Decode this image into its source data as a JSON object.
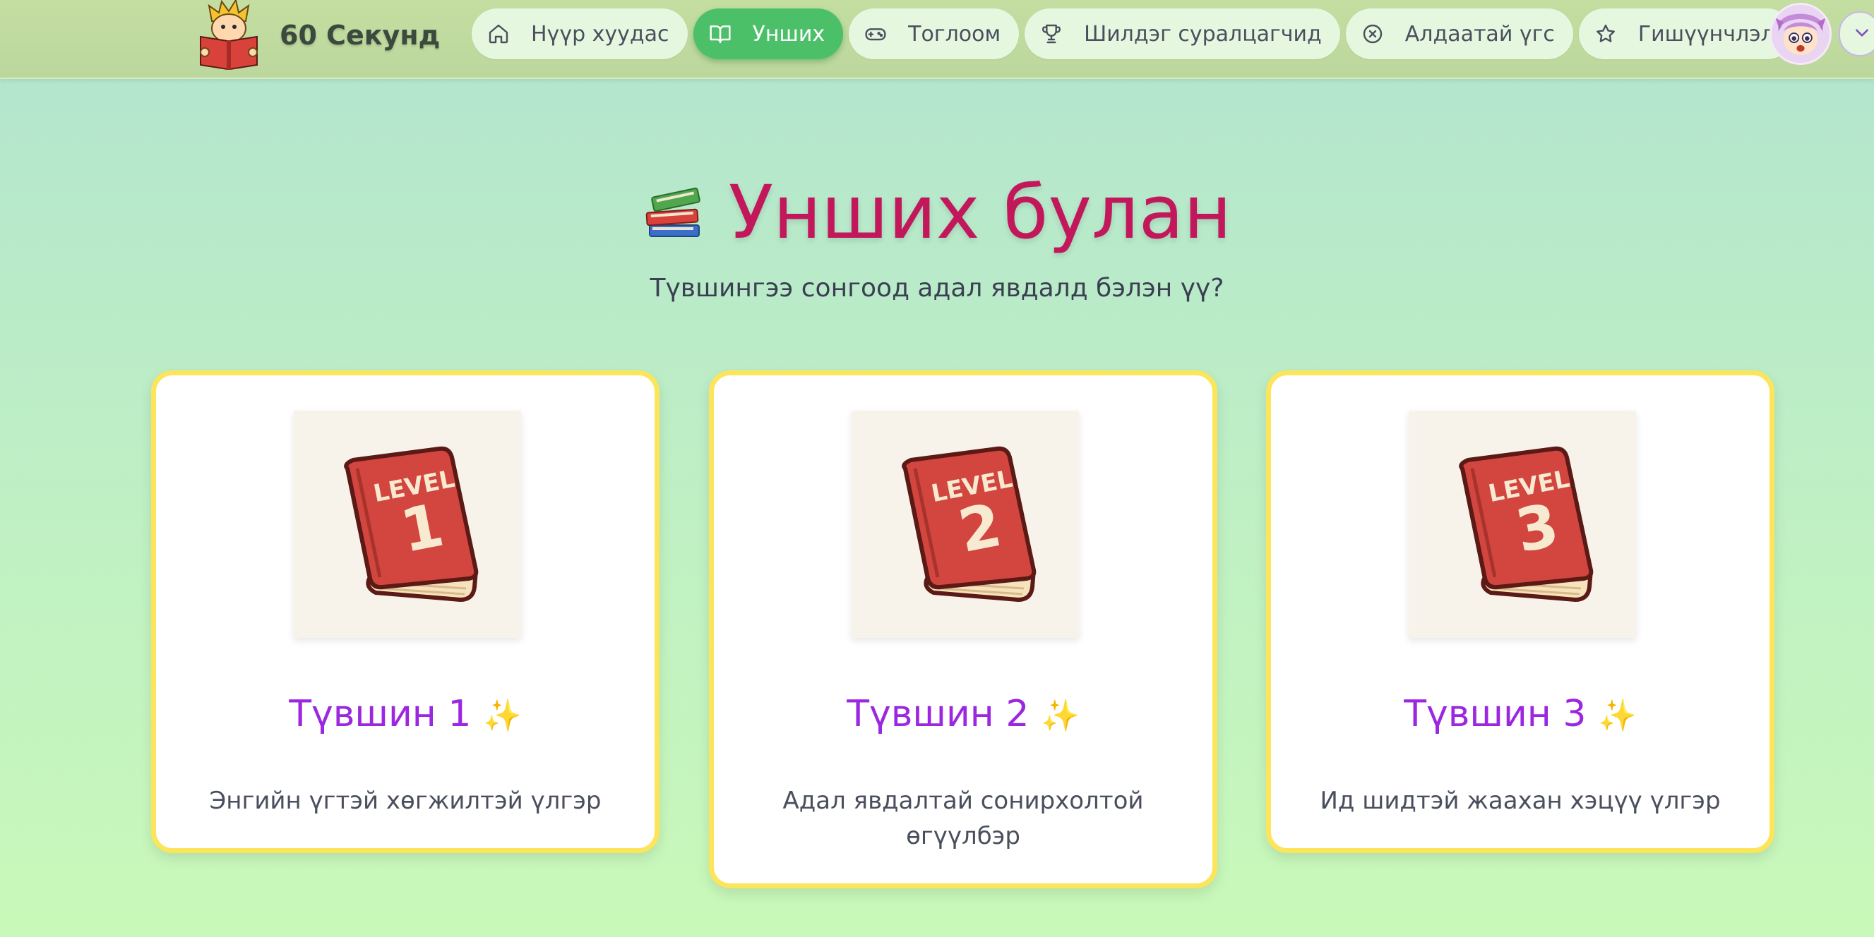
{
  "brand": {
    "name": "60 Секунд",
    "logo_icon": "boy-reading-book-logo"
  },
  "nav": {
    "items": [
      {
        "label": "Нүүр хуудас",
        "icon": "home-icon",
        "active": false
      },
      {
        "label": "Унших",
        "icon": "open-book-icon",
        "active": true
      },
      {
        "label": "Тоглоом",
        "icon": "gamepad-icon",
        "active": false
      },
      {
        "label": "Шилдэг суралцагчид",
        "icon": "trophy-icon",
        "active": false
      },
      {
        "label": "Алдаатай үгс",
        "icon": "x-circle-icon",
        "active": false
      },
      {
        "label": "Гишүүнчлэл",
        "icon": "star-icon",
        "active": false
      }
    ],
    "avatar_icon": "user-avatar",
    "dropdown_icon": "chevron-down-icon"
  },
  "hero": {
    "icon": "books-stack-icon",
    "title": "Унших булан",
    "subtitle": "Түвшингээ сонгоод адал явдалд бэлэн үү?"
  },
  "levels": [
    {
      "badge": "LEVEL",
      "number": "1",
      "title": "Түвшин 1",
      "spark": "✨",
      "description": "Энгийн үгтэй хөгжилтэй үлгэр"
    },
    {
      "badge": "LEVEL",
      "number": "2",
      "title": "Түвшин 2",
      "spark": "✨",
      "description": "Адал явдалтай сонирхолтой өгүүлбэр"
    },
    {
      "badge": "LEVEL",
      "number": "3",
      "title": "Түвшин 3",
      "spark": "✨",
      "description": "Ид шидтэй жаахан хэцүү үлгэр"
    }
  ],
  "colors": {
    "accent": "#c2185b",
    "nav_active": "#4cc069",
    "card_border": "#fde55b",
    "level_title": "#9c27e0",
    "book_red": "#d2463f"
  }
}
